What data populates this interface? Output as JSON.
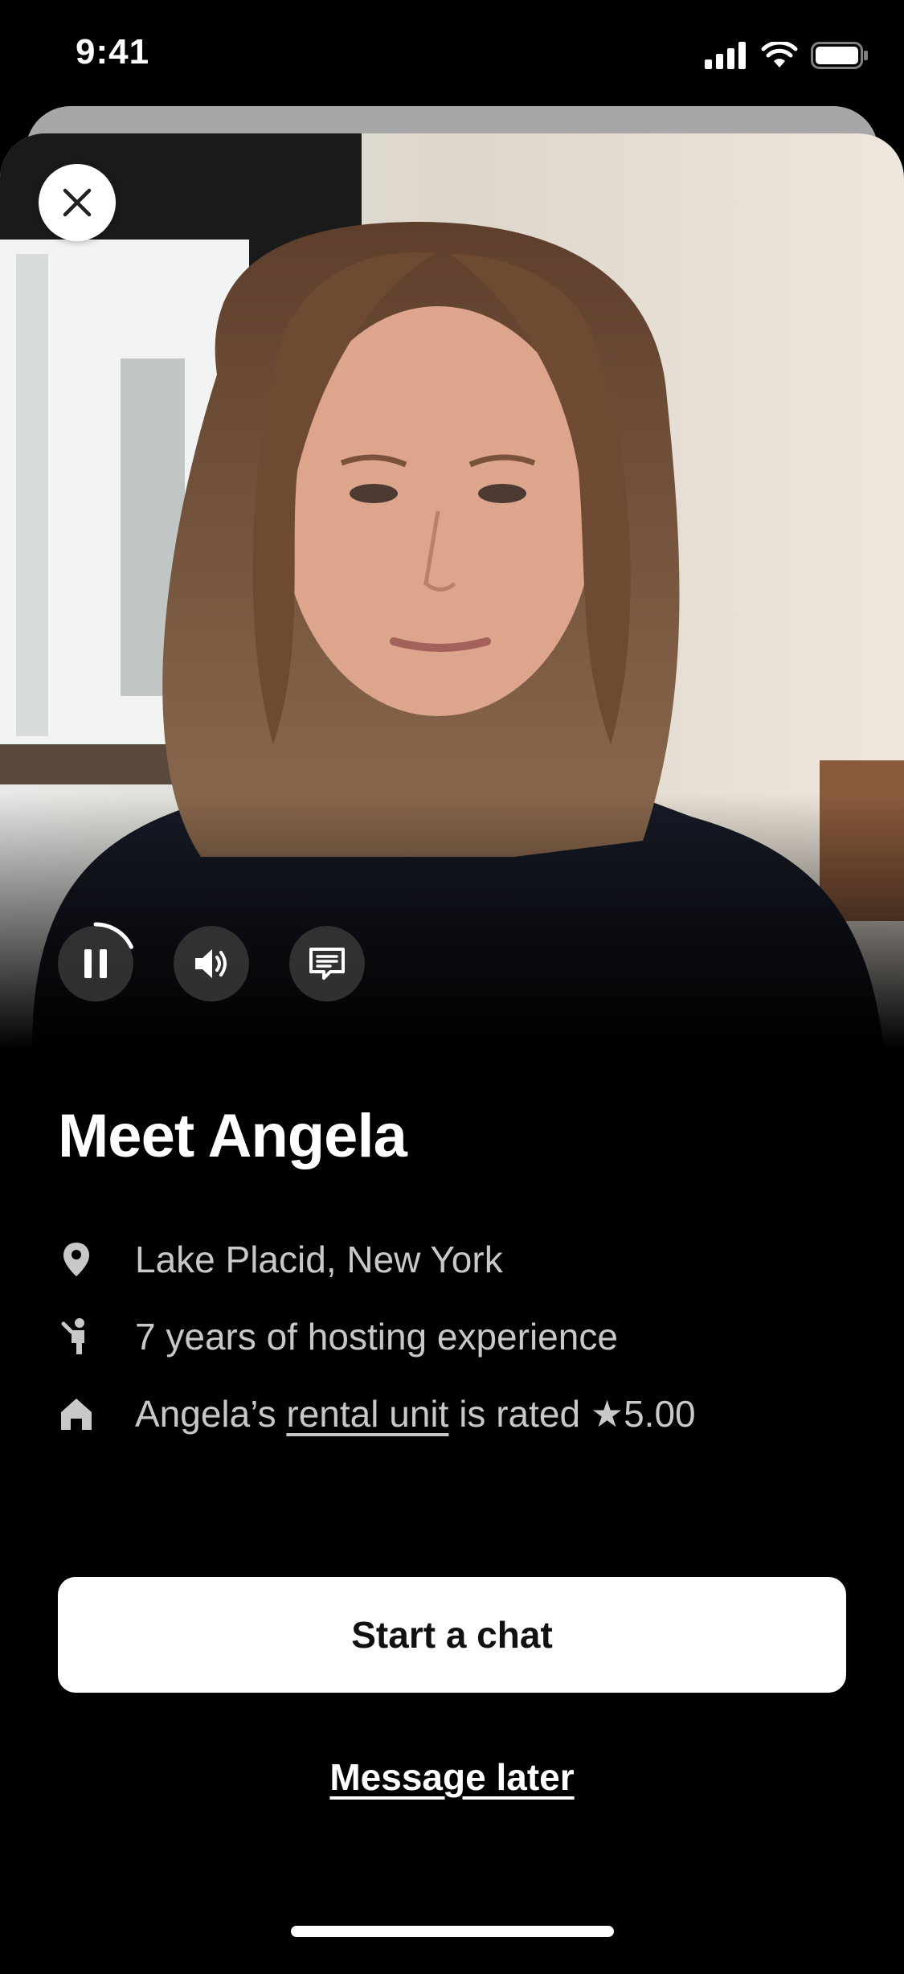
{
  "status_bar": {
    "time": "9:41",
    "icons": [
      "cellular-signal-icon",
      "wifi-icon",
      "battery-icon"
    ]
  },
  "video": {
    "controls": [
      {
        "icon": "pause-icon",
        "state": "playing"
      },
      {
        "icon": "volume-icon"
      },
      {
        "icon": "captions-icon"
      }
    ],
    "progress_fraction": 0.18
  },
  "host": {
    "title": "Meet Angela",
    "location": "Lake Placid, New York",
    "experience": "7 years of hosting experience",
    "rating_prefix": "Angela’s",
    "rating_link": "rental unit",
    "rating_middle": "is rated",
    "rating_value": "★5.00"
  },
  "actions": {
    "primary": "Start a chat",
    "secondary": "Message later"
  },
  "colors": {
    "background": "#000000",
    "text": "#ffffff",
    "secondary_text": "#c8c8c8",
    "button_bg": "#ffffff",
    "button_text": "#111111"
  }
}
